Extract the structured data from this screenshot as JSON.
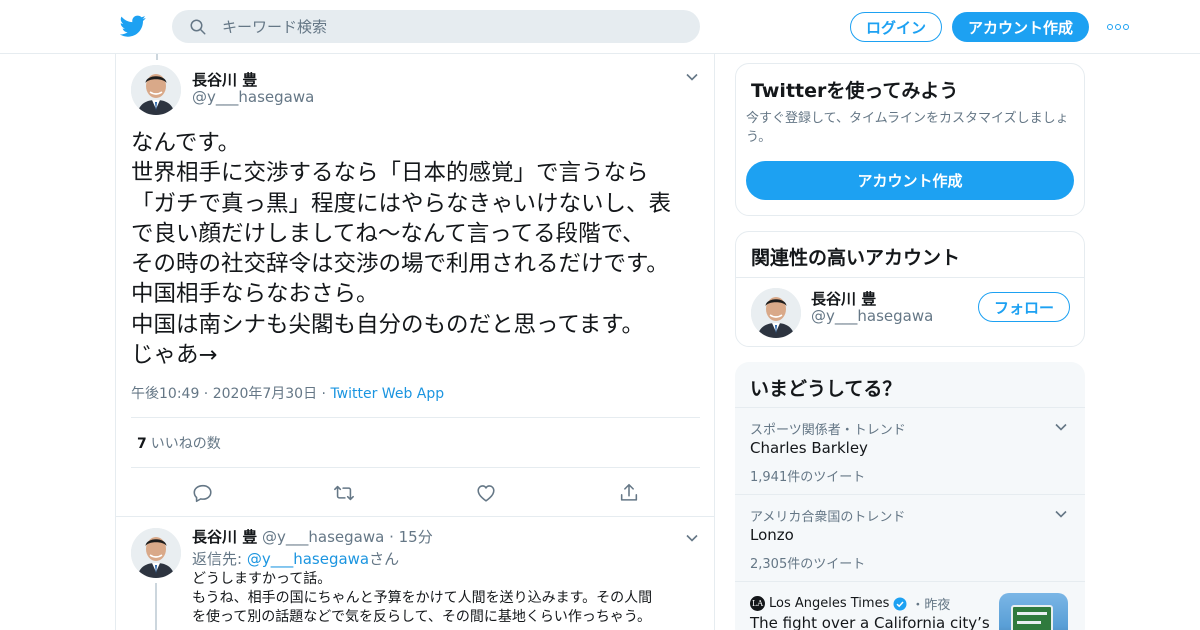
{
  "header": {
    "logo_icon": "twitter-bird-icon",
    "search_placeholder": "キーワード検索",
    "login_label": "ログイン",
    "signup_label": "アカウント作成",
    "more_icon": "more-dots-icon"
  },
  "tweet": {
    "name": "長谷川 豊",
    "handle": "@y___hasegawa",
    "text": "なんです。\n世界相手に交渉するなら「日本的感覚」で言うなら\n「ガチで真っ黒」程度にはやらなきゃいけないし、表\nで良い顔だけしましてね～なんて言ってる段階で、\nその時の社交辞令は交渉の場で利用されるだけです。\n中国相手ならなおさら。\n中国は南シナも尖閣も自分のものだと思ってます。\nじゃあ→",
    "time": "午後10:49",
    "date": "2020年7月30日",
    "source": "Twitter Web App",
    "like_count": "7",
    "like_label": "いいねの数"
  },
  "reply": {
    "name": "長谷川 豊",
    "handle": "@y___hasegawa",
    "age": "15分",
    "reply_to_prefix": "返信先: ",
    "reply_to_handle": "@y___hasegawa",
    "reply_to_suffix": "さん",
    "text": "どうしますかって話。\nもうね、相手の国にちゃんと予算をかけて人間を送り込みます。その人間\nを使って別の話題などで気を反らして、その間に基地くらい作っちゃう。"
  },
  "sidebar": {
    "signup_card": {
      "title": "Twitterを使ってみよう",
      "subtitle": "今すぐ登録して、タイムラインをカスタマイズしましょう。",
      "button": "アカウント作成"
    },
    "related": {
      "title": "関連性の高いアカウント",
      "name": "長谷川 豊",
      "handle": "@y___hasegawa",
      "follow": "フォロー"
    },
    "trends": {
      "title": "いまどうしてる？",
      "items": [
        {
          "context": "スポーツ関係者・トレンド",
          "name": "Charles Barkley",
          "count": "1,941件のツイート"
        },
        {
          "context": "アメリカ合衆国のトレンド",
          "name": "Lonzo",
          "count": "2,305件のツイート"
        }
      ],
      "news": {
        "source": "Los Angeles Times",
        "time": "・昨夜",
        "headline": "The fight over a California city’s"
      }
    }
  },
  "colors": {
    "accent": "#1da1f2",
    "link": "#1b95e0",
    "muted": "#657786",
    "border": "#e6ecf0"
  }
}
